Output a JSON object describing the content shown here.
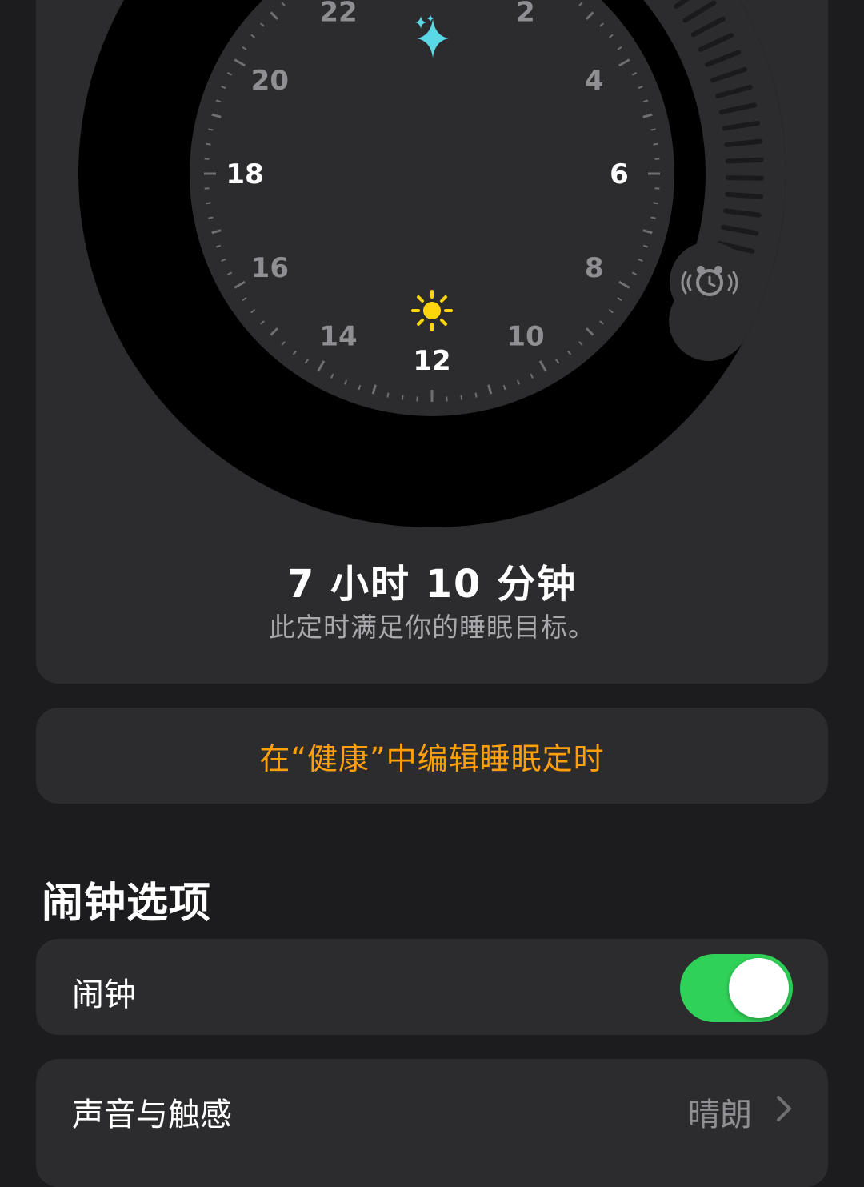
{
  "clock": {
    "hour_labels": [
      {
        "text": "22",
        "color": "#8e8e93"
      },
      {
        "text": "2",
        "color": "#8e8e93"
      },
      {
        "text": "20",
        "color": "#8e8e93"
      },
      {
        "text": "4",
        "color": "#8e8e93"
      },
      {
        "text": "18",
        "color": "#ffffff"
      },
      {
        "text": "6",
        "color": "#ffffff"
      },
      {
        "text": "16",
        "color": "#8e8e93"
      },
      {
        "text": "8",
        "color": "#8e8e93"
      },
      {
        "text": "14",
        "color": "#8e8e93"
      },
      {
        "text": "10",
        "color": "#8e8e93"
      },
      {
        "text": "12",
        "color": "#ffffff"
      }
    ],
    "bedtime_icon": "sparkles-icon",
    "wake_icon": "alarm-clock-icon",
    "noon_icon": "sun-icon",
    "bedtime_icon_color": "#5ad8e6",
    "sun_icon_color": "#ffd60a"
  },
  "summary": {
    "duration": "7 小时 10 分钟",
    "subtitle": "此定时满足你的睡眠目标。"
  },
  "edit_link": "在“健康”中编辑睡眠定时",
  "alarm_options": {
    "title": "闹钟选项",
    "alarm_label": "闹钟",
    "alarm_on": true,
    "sound_label": "声音与触感",
    "sound_value": "晴朗"
  },
  "colors": {
    "background": "#1c1c1e",
    "card": "#2c2c2e",
    "accent_orange": "#ff9f0a",
    "toggle_on": "#30d158"
  }
}
